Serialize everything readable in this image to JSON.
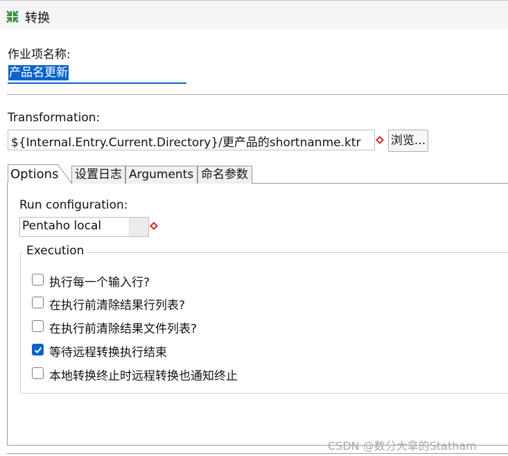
{
  "window": {
    "title": "转换",
    "icon": "transformation-icon"
  },
  "job_entry": {
    "name_label": "作业项名称:",
    "name_value": "产品名更新"
  },
  "transformation": {
    "label": "Transformation:",
    "path_value": "${Internal.Entry.Current.Directory}/更产品的shortnanme.ktr",
    "browse_label": "浏览..."
  },
  "tabs": [
    {
      "label": "Options",
      "active": true
    },
    {
      "label": "设置日志",
      "active": false
    },
    {
      "label": "Arguments",
      "active": false
    },
    {
      "label": "命名参数",
      "active": false
    }
  ],
  "options": {
    "run_config_label": "Run configuration:",
    "run_config_value": "Pentaho local",
    "execution_title": "Execution",
    "checkboxes": [
      {
        "label": "执行每一个输入行?",
        "checked": false
      },
      {
        "label": "在执行前清除结果行列表?",
        "checked": false
      },
      {
        "label": "在执行前清除结果文件列表?",
        "checked": false
      },
      {
        "label": "等待远程转换执行结束",
        "checked": true
      },
      {
        "label": "本地转换终止时远程转换也通知终止",
        "checked": false
      }
    ]
  },
  "watermark": "CSDN @数分大拿的Statham",
  "colors": {
    "accent": "#0a64c8",
    "variable_marker": "#d0302a",
    "icon_green": "#2e8b3a"
  }
}
